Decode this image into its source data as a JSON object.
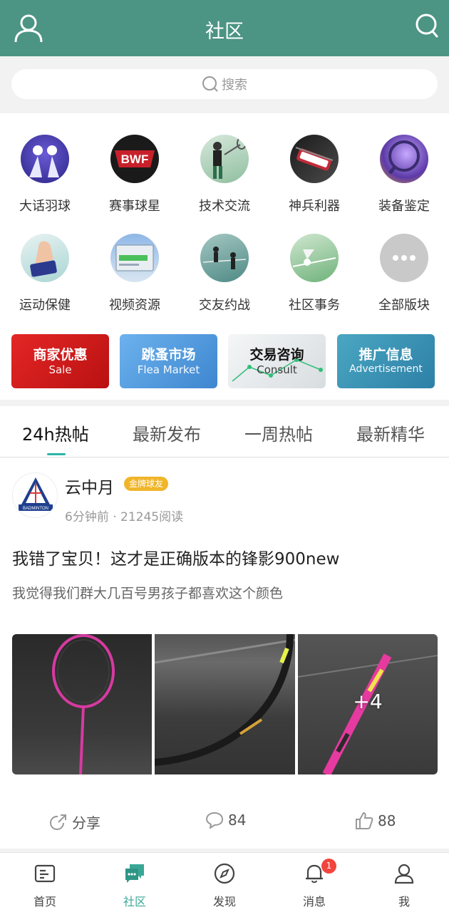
{
  "header": {
    "title": "社区",
    "user_icon": "user-icon",
    "search_icon": "search-icon"
  },
  "search": {
    "placeholder": "搜索"
  },
  "categories": [
    {
      "label": "大话羽球",
      "icon": "shuttlecock-icon"
    },
    {
      "label": "赛事球星",
      "icon": "bwf-logo-icon"
    },
    {
      "label": "技术交流",
      "icon": "player-icon"
    },
    {
      "label": "神兵利器",
      "icon": "racket-bag-icon"
    },
    {
      "label": "装备鉴定",
      "icon": "magnifier-icon"
    },
    {
      "label": "运动保健",
      "icon": "wristband-icon"
    },
    {
      "label": "视频资源",
      "icon": "video-icon"
    },
    {
      "label": "交友约战",
      "icon": "court-icon"
    },
    {
      "label": "社区事务",
      "icon": "shuttle-court-icon"
    },
    {
      "label": "全部版块",
      "icon": "more-icon"
    }
  ],
  "banners": [
    {
      "title": "商家优惠",
      "subtitle": "Sale",
      "color": "#d71f1f"
    },
    {
      "title": "跳蚤市场",
      "subtitle": "Flea Market",
      "color": "#5fa2de"
    },
    {
      "title": "交易咨询",
      "subtitle": "Consult",
      "color": "#e8ecef"
    },
    {
      "title": "推广信息",
      "subtitle": "Advertisement",
      "color": "#3a9bb5"
    }
  ],
  "tabs": [
    {
      "label": "24h热帖",
      "active": true
    },
    {
      "label": "最新发布"
    },
    {
      "label": "一周热帖"
    },
    {
      "label": "最新精华"
    }
  ],
  "post": {
    "author": "云中月",
    "badge": "金牌球友",
    "avatar_text": "BADMINTON",
    "meta": "6分钟前 · 21245阅读",
    "title": "我错了宝贝！这才是正确版本的锋影900new",
    "body": "我觉得我们群大几百号男孩子都喜欢这个颜色",
    "more_photos": "+4",
    "share_label": "分享",
    "comments": "84",
    "likes": "88"
  },
  "bottom_nav": [
    {
      "label": "首页",
      "icon": "home-icon"
    },
    {
      "label": "社区",
      "icon": "community-icon",
      "active": true
    },
    {
      "label": "发现",
      "icon": "compass-icon"
    },
    {
      "label": "消息",
      "icon": "bell-icon",
      "badge": "1"
    },
    {
      "label": "我",
      "icon": "profile-icon"
    }
  ],
  "colors": {
    "header_bg": "#4c9484",
    "accent": "#3aa796",
    "badge_gold": "#f0b52a",
    "notif_red": "#f1453d"
  }
}
